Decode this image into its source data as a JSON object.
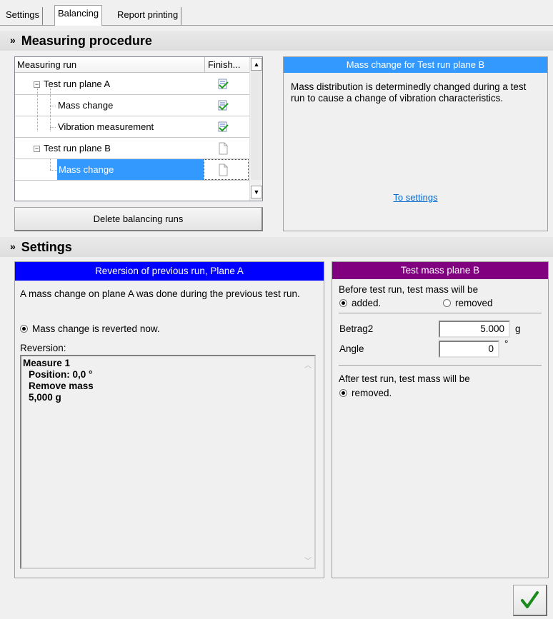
{
  "tabs": [
    {
      "label": "Settings",
      "selected": false
    },
    {
      "label": "Balancing",
      "selected": true
    },
    {
      "label": "Report printing",
      "selected": false
    }
  ],
  "procedure": {
    "header": "Measuring procedure",
    "columns": [
      "Measuring run",
      "Finish..."
    ],
    "rows": [
      {
        "label": "Test run plane A",
        "finished": true
      },
      {
        "label": "Mass change",
        "finished": true
      },
      {
        "label": "Vibration measurement",
        "finished": true
      },
      {
        "label": "Test run plane B",
        "finished": false
      },
      {
        "label": "Mass change",
        "finished": false,
        "selected": true
      }
    ],
    "delete_label": "Delete balancing runs"
  },
  "info": {
    "title": "Mass change for Test run plane B",
    "description": "Mass distribution is determinedly changed during a test run to cause a change of vibration characteristics.",
    "link": "To settings"
  },
  "settings": {
    "header": "Settings",
    "reversion": {
      "title": "Reversion of previous run, Plane A",
      "text": "A mass change on plane A was done during the previous test run.",
      "option": "Mass change is reverted now.",
      "label": "Reversion:",
      "lines": [
        "Measure 1",
        "Position: 0,0 °",
        "Remove mass",
        "5,000 g"
      ]
    },
    "testmass": {
      "title": "Test mass plane B",
      "before_text": "Before test run, test mass will be",
      "opt_added": "added.",
      "opt_removed": "removed",
      "betrag_label": "Betrag2",
      "betrag_value": "5.000",
      "betrag_unit": "g",
      "angle_label": "Angle",
      "angle_value": "0",
      "angle_unit": "°",
      "after_text": "After test run, test mass will be",
      "after_opt": "removed."
    }
  },
  "colors": {
    "info_title_bg": "#3399ff",
    "reversion_title_bg": "#0000ff",
    "testmass_title_bg": "#800080",
    "ok_check": "#1a8a1a"
  }
}
